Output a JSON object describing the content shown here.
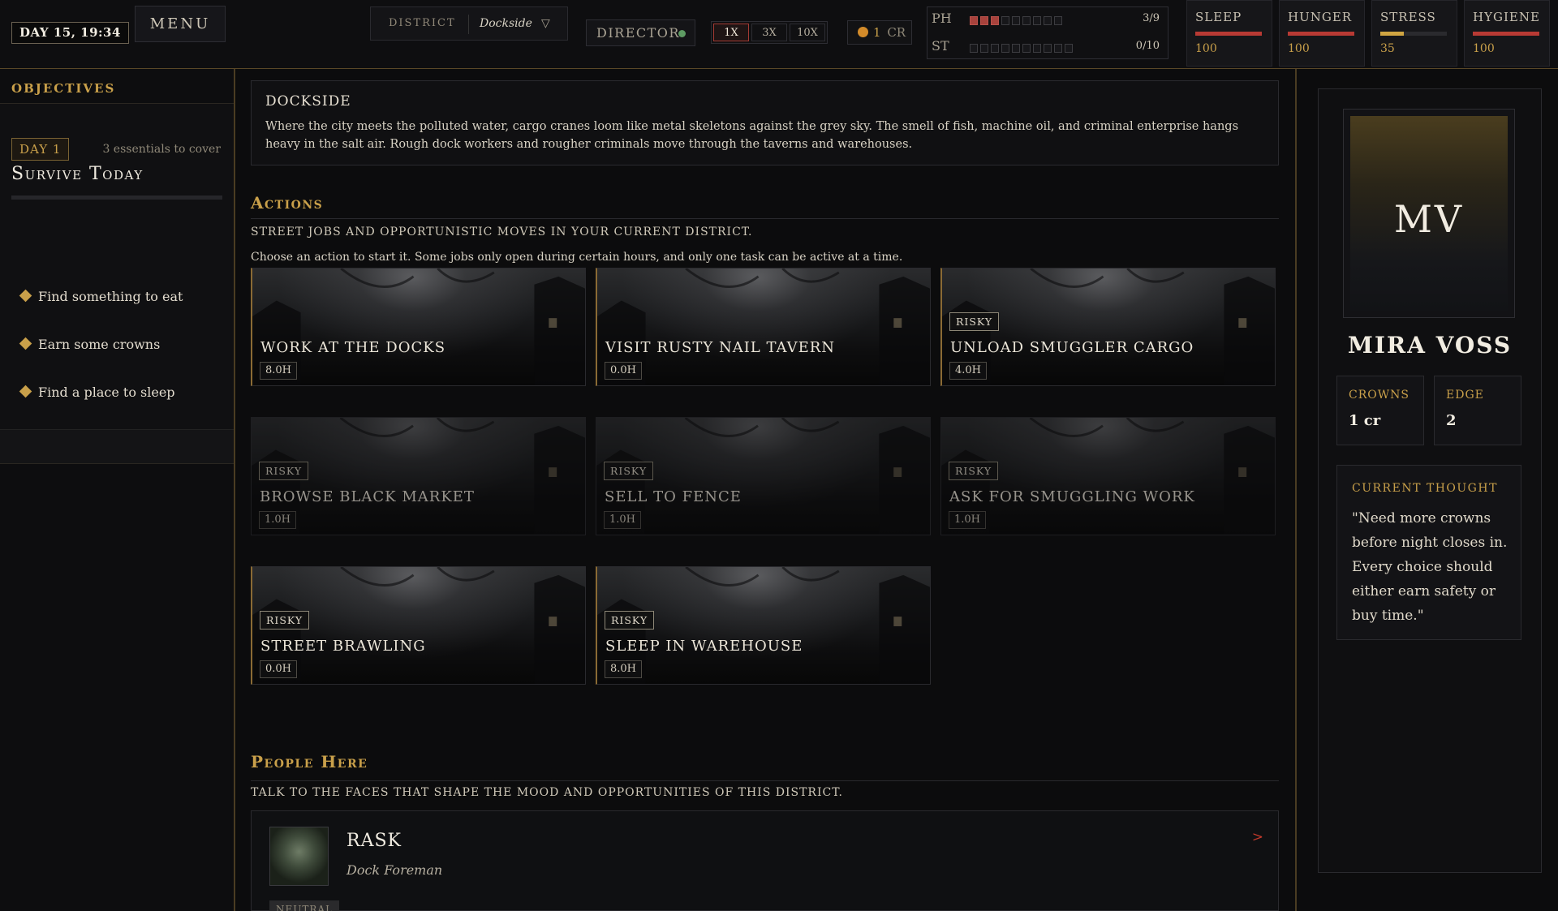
{
  "topbar": {
    "clock": "DAY 15, 19:34",
    "menu_label": "MENU",
    "district_label": "DISTRICT",
    "district_value": "Dockside",
    "director_label": "DIRECTOR",
    "speeds": [
      "1X",
      "3X",
      "10X"
    ],
    "active_speed": "1X",
    "coins": "1",
    "coin_unit": "CR",
    "ph": {
      "label": "PH",
      "value": "3/9",
      "filled": 3,
      "total": 9
    },
    "st": {
      "label": "ST",
      "value": "0/10",
      "filled": 0,
      "total": 10
    },
    "needs": [
      {
        "label": "SLEEP",
        "value": "100",
        "fraction": 1.0,
        "color": "#b83a34"
      },
      {
        "label": "HUNGER",
        "value": "100",
        "fraction": 1.0,
        "color": "#b83a34"
      },
      {
        "label": "STRESS",
        "value": "35",
        "fraction": 0.35,
        "color": "#d0a542"
      },
      {
        "label": "HYGIENE",
        "value": "100",
        "fraction": 1.0,
        "color": "#b83a34"
      }
    ]
  },
  "sidebar": {
    "heading": "OBJECTIVES",
    "day_badge": "DAY 1",
    "essentials": "3 essentials to cover",
    "goal_title": "Survive Today",
    "items": [
      "Find something to eat",
      "Earn some crowns",
      "Find a place to sleep"
    ]
  },
  "district": {
    "title": "DOCKSIDE",
    "description": "Where the city meets the polluted water, cargo cranes loom like metal skeletons against the grey sky. The smell of fish, machine oil, and criminal enterprise hangs heavy in the salt air. Rough dock workers and rougher criminals move through the taverns and warehouses."
  },
  "actions": {
    "title": "Actions",
    "subtitle": "STREET JOBS AND OPPORTUNISTIC MOVES IN YOUR CURRENT DISTRICT.",
    "help": "Choose an action to start it. Some jobs only open during certain hours, and only one task can be active at a time.",
    "risky_label": "RISKY",
    "cards": [
      {
        "title": "WORK AT THE DOCKS",
        "hours": "8.0H",
        "risky": false,
        "available": true
      },
      {
        "title": "VISIT RUSTY NAIL TAVERN",
        "hours": "0.0H",
        "risky": false,
        "available": true
      },
      {
        "title": "UNLOAD SMUGGLER CARGO",
        "hours": "4.0H",
        "risky": true,
        "available": true
      },
      {
        "title": "BROWSE BLACK MARKET",
        "hours": "1.0H",
        "risky": true,
        "available": false
      },
      {
        "title": "SELL TO FENCE",
        "hours": "1.0H",
        "risky": true,
        "available": false
      },
      {
        "title": "ASK FOR SMUGGLING WORK",
        "hours": "1.0H",
        "risky": true,
        "available": false
      },
      {
        "title": "STREET BRAWLING",
        "hours": "0.0H",
        "risky": true,
        "available": true
      },
      {
        "title": "SLEEP IN WAREHOUSE",
        "hours": "8.0H",
        "risky": true,
        "available": true
      }
    ]
  },
  "people": {
    "title": "People Here",
    "subtitle": "TALK TO THE FACES THAT SHAPE THE MOOD AND OPPORTUNITIES OF THIS DISTRICT.",
    "list": [
      {
        "name": "RASK",
        "role": "Dock Foreman",
        "disposition": "NEUTRAL",
        "arrow": ">"
      }
    ]
  },
  "character": {
    "initials": "MV",
    "name": "MIRA VOSS",
    "crowns_label": "CROWNS",
    "crowns_value": "1 cr",
    "edge_label": "EDGE",
    "edge_value": "2",
    "thought_label": "CURRENT THOUGHT",
    "thought": "\"Need more crowns before night closes in. Every choice should either earn safety or buy time.\""
  }
}
